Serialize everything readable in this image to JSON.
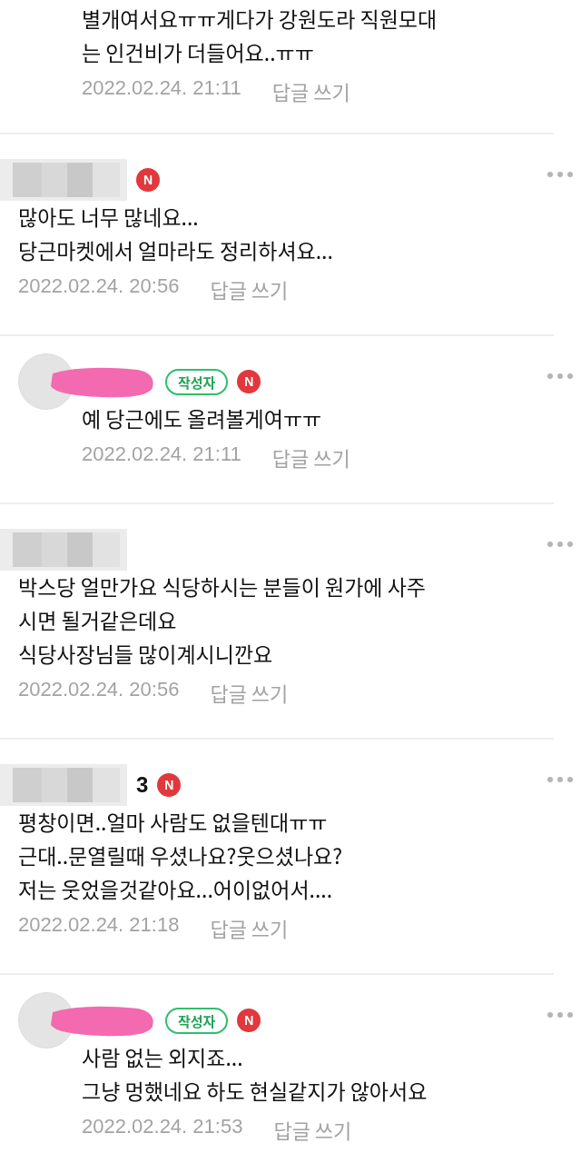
{
  "comments": [
    {
      "kind": "reply",
      "header_visible": false,
      "lines": [
        "별개여서요ㅠㅠ게다가 강원도라 직원모대",
        "는 인건비가 더들어요..ㅠㅠ"
      ],
      "date": "2022.02.24. 21:11",
      "reply_link": "답글 쓰기"
    },
    {
      "kind": "comment",
      "header_visible": true,
      "new_badge": "N",
      "lines": [
        "많아도 너무 많네요...",
        "당근마켓에서 얼마라도 정리하셔요..."
      ],
      "date": "2022.02.24. 20:56",
      "reply_link": "답글 쓰기"
    },
    {
      "kind": "reply",
      "header_visible": true,
      "author_badge": "작성자",
      "new_badge": "N",
      "lines": [
        "예 당근에도 올려볼게여ㅠㅠ"
      ],
      "date": "2022.02.24. 21:11",
      "reply_link": "답글 쓰기"
    },
    {
      "kind": "comment",
      "header_visible": true,
      "lines": [
        "박스당 얼만가요 식당하시는 분들이 원가에 사주",
        "시면 될거같은데요",
        "식당사장님들 많이계시니깐요"
      ],
      "date": "2022.02.24. 20:56",
      "reply_link": "답글 쓰기"
    },
    {
      "kind": "comment",
      "header_visible": true,
      "name": "3",
      "new_badge": "N",
      "lines": [
        "평창이면..얼마 사람도 없을텐대ㅠㅠ",
        "근대..문열릴때 우셨나요?웃으셨나요?",
        "저는 웃었을것같아요...어이없어서...."
      ],
      "date": "2022.02.24. 21:18",
      "reply_link": "답글 쓰기"
    },
    {
      "kind": "reply",
      "header_visible": true,
      "author_badge": "작성자",
      "new_badge": "N",
      "lines": [
        "사람 없는 외지죠...",
        "그냥 멍했네요 하도 현실같지가 않아서요"
      ],
      "date": "2022.02.24. 21:53",
      "reply_link": "답글 쓰기"
    }
  ]
}
